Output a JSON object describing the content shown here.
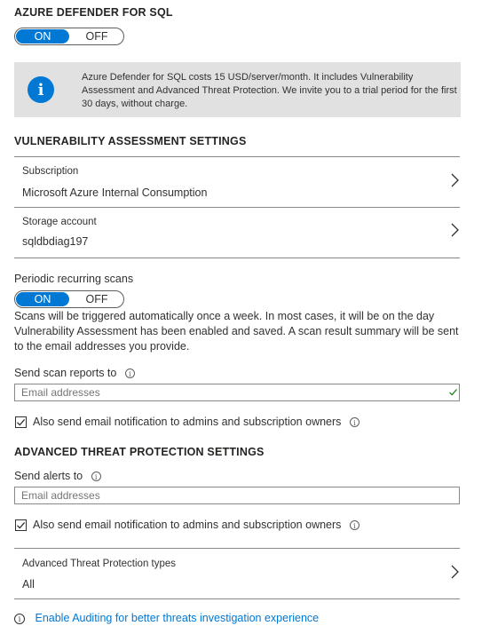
{
  "defender": {
    "title": "AZURE DEFENDER FOR SQL",
    "toggle": {
      "on_label": "ON",
      "off_label": "OFF",
      "state": "ON"
    },
    "info_text": "Azure Defender for SQL costs 15 USD/server/month. It includes Vulnerability Assessment and Advanced Threat Protection. We invite you to a trial period for the first 30 days, without charge."
  },
  "va_settings": {
    "title": "VULNERABILITY ASSESSMENT SETTINGS",
    "subscription": {
      "label": "Subscription",
      "value": "Microsoft Azure Internal Consumption"
    },
    "storage": {
      "label": "Storage account",
      "value": "sqldbdiag197"
    },
    "periodic_scans": {
      "label": "Periodic recurring scans",
      "toggle": {
        "on_label": "ON",
        "off_label": "OFF",
        "state": "ON"
      },
      "description": "Scans will be triggered automatically once a week. In most cases, it will be on the day Vulnerability Assessment has been enabled and saved. A scan result summary will be sent to the email addresses you provide."
    },
    "send_reports": {
      "label": "Send scan reports to",
      "placeholder": "Email addresses",
      "valid": true
    },
    "notify_admins": {
      "label": "Also send email notification to admins and subscription owners",
      "checked": true
    }
  },
  "atp_settings": {
    "title": "ADVANCED THREAT PROTECTION SETTINGS",
    "send_alerts": {
      "label": "Send alerts to",
      "placeholder": "Email addresses"
    },
    "notify_admins": {
      "label": "Also send email notification to admins and subscription owners",
      "checked": true
    },
    "types": {
      "label": "Advanced Threat Protection types",
      "value": "All"
    }
  },
  "auditing_link": "Enable Auditing for better threats investigation experience",
  "colors": {
    "accent": "#0078d4",
    "banner_bg": "#e1e1e1",
    "success": "#107c10"
  }
}
